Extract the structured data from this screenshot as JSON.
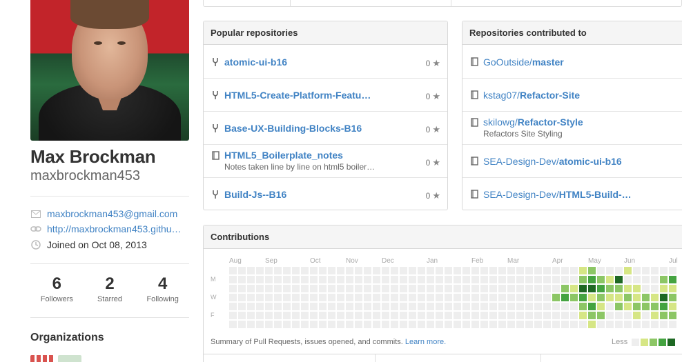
{
  "profile": {
    "name": "Max Brockman",
    "username": "maxbrockman453",
    "email": "maxbrockman453@gmail.com",
    "website": "http://maxbrockman453.githu…",
    "joined": "Joined on Oct 08, 2013",
    "stats": [
      {
        "value": "6",
        "label": "Followers"
      },
      {
        "value": "2",
        "label": "Starred"
      },
      {
        "value": "4",
        "label": "Following"
      }
    ],
    "organizations_title": "Organizations"
  },
  "popular": {
    "title": "Popular repositories",
    "repos": [
      {
        "name": "atomic-ui-b16",
        "description": "",
        "stars": "0",
        "icon": "fork-icon"
      },
      {
        "name": "HTML5-Create-Platform-Featu…",
        "description": "",
        "stars": "0",
        "icon": "fork-icon"
      },
      {
        "name": "Base-UX-Building-Blocks-B16",
        "description": "",
        "stars": "0",
        "icon": "fork-icon"
      },
      {
        "name": "HTML5_Boilerplate_notes",
        "description": "Notes taken line by line on html5 boiler…",
        "stars": "0",
        "icon": "repo-icon"
      },
      {
        "name": "Build-Js--B16",
        "description": "",
        "stars": "0",
        "icon": "fork-icon"
      }
    ]
  },
  "contributed": {
    "title": "Repositories contributed to",
    "repos": [
      {
        "owner": "GoOutside/",
        "name": "master",
        "description": ""
      },
      {
        "owner": "kstag07/",
        "name": "Refactor-Site",
        "description": ""
      },
      {
        "owner": "skilowg/",
        "name": "Refactor-Style",
        "description": "Refactors Site Styling"
      },
      {
        "owner": "SEA-Design-Dev/",
        "name": "atomic-ui-b16",
        "description": ""
      },
      {
        "owner": "SEA-Design-Dev/",
        "name": "HTML5-Build-…",
        "description": ""
      }
    ]
  },
  "contributions": {
    "title": "Contributions",
    "months": [
      "Aug",
      "Sep",
      "Oct",
      "Nov",
      "Dec",
      "Jan",
      "Feb",
      "Mar",
      "Apr",
      "May",
      "Jun",
      "Jul"
    ],
    "days": [
      "M",
      "W",
      "F"
    ],
    "summary": "Summary of Pull Requests, issues opened, and commits.",
    "learn_more": "Learn more.",
    "legend_less": "Less",
    "colors": {
      "empty": "#eeeeee",
      "l1": "#d6e685",
      "l2": "#8cc665",
      "l3": "#44a340",
      "l4": "#1e6823"
    },
    "active": [
      [
        36,
        3,
        2
      ],
      [
        37,
        2,
        2
      ],
      [
        37,
        3,
        3
      ],
      [
        38,
        2,
        1
      ],
      [
        38,
        3,
        2
      ],
      [
        39,
        0,
        1
      ],
      [
        39,
        1,
        2
      ],
      [
        39,
        2,
        4
      ],
      [
        39,
        3,
        3
      ],
      [
        39,
        4,
        2
      ],
      [
        39,
        5,
        1
      ],
      [
        40,
        0,
        2
      ],
      [
        40,
        1,
        3
      ],
      [
        40,
        2,
        4
      ],
      [
        40,
        3,
        1
      ],
      [
        40,
        4,
        3
      ],
      [
        40,
        5,
        2
      ],
      [
        40,
        6,
        1
      ],
      [
        41,
        1,
        2
      ],
      [
        41,
        2,
        3
      ],
      [
        41,
        3,
        2
      ],
      [
        41,
        4,
        1
      ],
      [
        41,
        5,
        2
      ],
      [
        42,
        1,
        1
      ],
      [
        42,
        2,
        2
      ],
      [
        42,
        3,
        1
      ],
      [
        43,
        1,
        4
      ],
      [
        43,
        2,
        2
      ],
      [
        43,
        3,
        1
      ],
      [
        43,
        4,
        2
      ],
      [
        44,
        0,
        1
      ],
      [
        44,
        2,
        1
      ],
      [
        44,
        3,
        2
      ],
      [
        44,
        4,
        1
      ],
      [
        45,
        2,
        1
      ],
      [
        45,
        3,
        1
      ],
      [
        45,
        4,
        2
      ],
      [
        45,
        5,
        1
      ],
      [
        46,
        3,
        2
      ],
      [
        46,
        4,
        2
      ],
      [
        47,
        3,
        1
      ],
      [
        47,
        4,
        2
      ],
      [
        47,
        5,
        1
      ],
      [
        48,
        1,
        2
      ],
      [
        48,
        2,
        1
      ],
      [
        48,
        3,
        4
      ],
      [
        48,
        4,
        3
      ],
      [
        48,
        5,
        2
      ],
      [
        49,
        1,
        3
      ],
      [
        49,
        2,
        1
      ],
      [
        49,
        3,
        2
      ],
      [
        49,
        4,
        1
      ],
      [
        49,
        5,
        2
      ],
      [
        50,
        0,
        1
      ],
      [
        50,
        1,
        2
      ],
      [
        50,
        2,
        1
      ],
      [
        50,
        3,
        1
      ],
      [
        51,
        0,
        2
      ],
      [
        51,
        3,
        1
      ]
    ]
  }
}
